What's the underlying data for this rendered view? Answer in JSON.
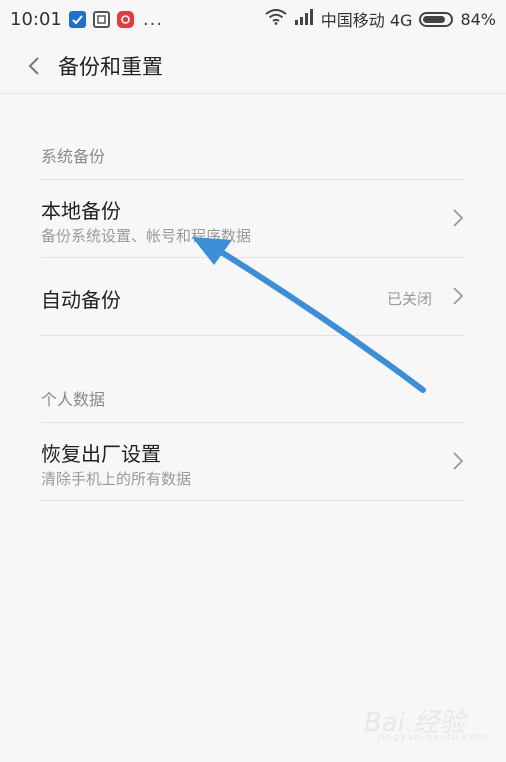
{
  "status_bar": {
    "time": "10:01",
    "more": "...",
    "carrier": "中国移动 4G",
    "battery_text": "84%",
    "battery_level": 0.84
  },
  "title_bar": {
    "title": "备份和重置"
  },
  "sections": [
    {
      "header": "系统备份",
      "items": [
        {
          "title": "本地备份",
          "subtitle": "备份系统设置、帐号和程序数据"
        },
        {
          "title": "自动备份",
          "value": "已关闭"
        }
      ]
    },
    {
      "header": "个人数据",
      "items": [
        {
          "title": "恢复出厂设置",
          "subtitle": "清除手机上的所有数据"
        }
      ]
    }
  ],
  "watermark": {
    "text": "Bai 经验",
    "sub": "jingyan.baidu.com"
  },
  "colors": {
    "annotation_arrow": "#3a8fd8",
    "accent_blue": "#1e6fd0",
    "accent_red": "#e23b3b"
  }
}
